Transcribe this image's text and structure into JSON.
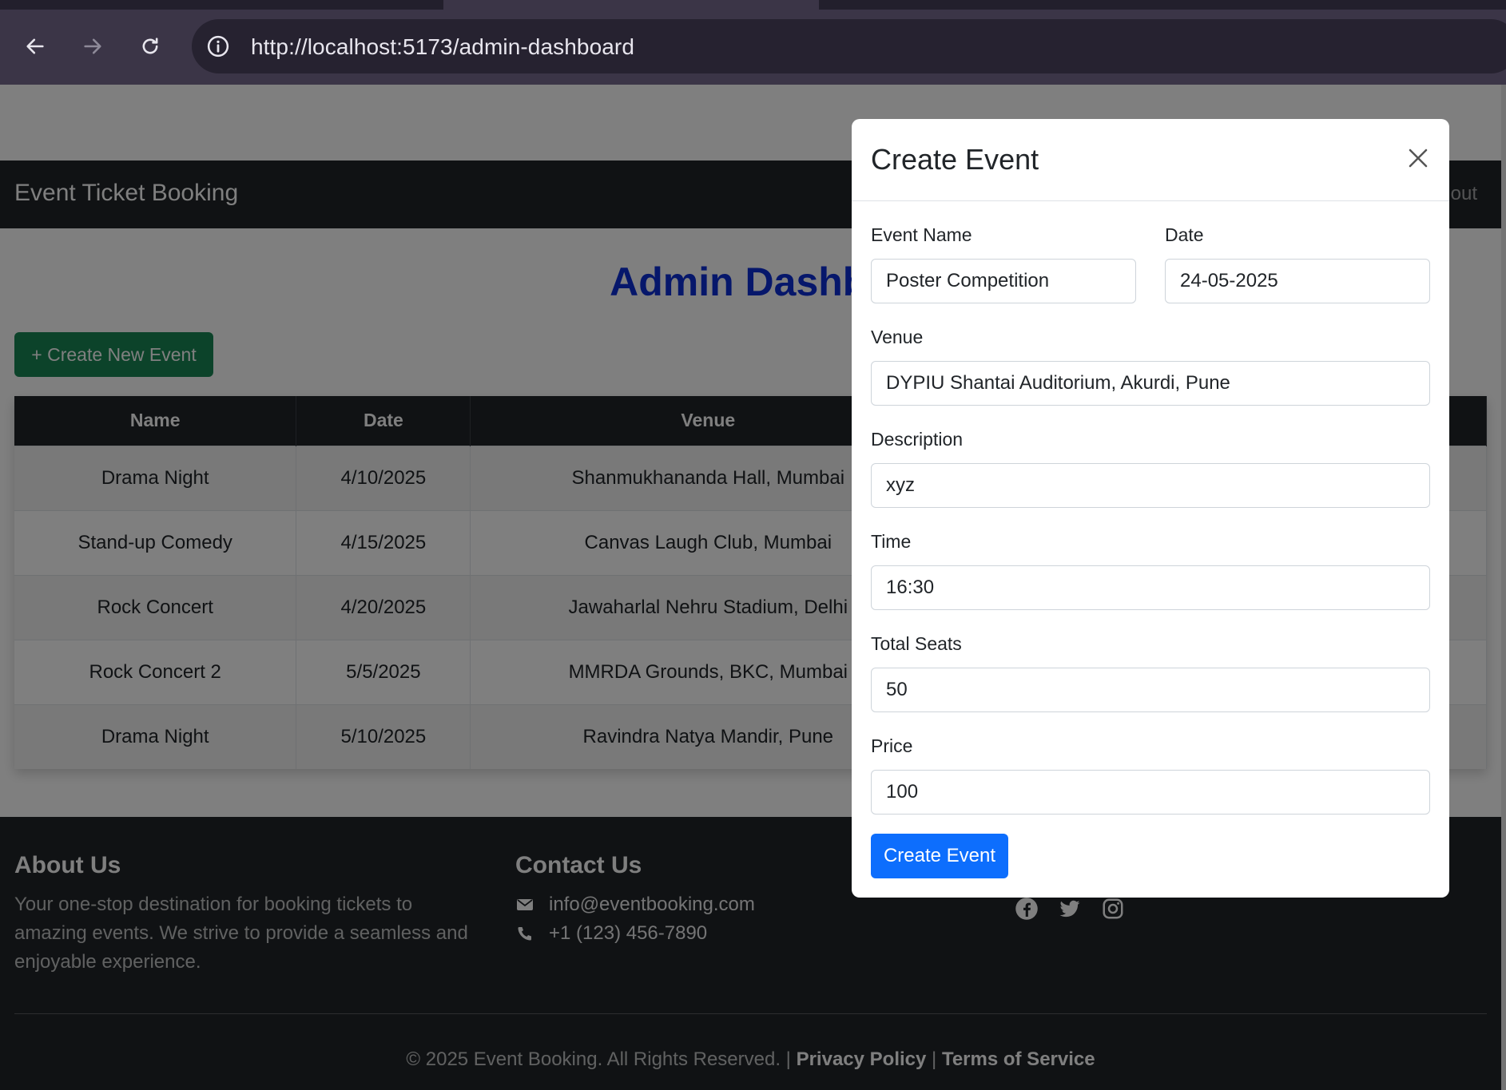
{
  "browser": {
    "url": "http://localhost:5173/admin-dashboard"
  },
  "navbar": {
    "brand": "Event Ticket Booking",
    "logout_partial": "out"
  },
  "dashboard": {
    "title": "Admin Dashbo",
    "create_button": "+ Create New Event"
  },
  "table": {
    "headers": [
      "Name",
      "Date",
      "Venue"
    ],
    "rows": [
      {
        "name": "Drama Night",
        "date": "4/10/2025",
        "venue": "Shanmukhananda Hall, Mumbai"
      },
      {
        "name": "Stand-up Comedy",
        "date": "4/15/2025",
        "venue": "Canvas Laugh Club, Mumbai"
      },
      {
        "name": "Rock Concert",
        "date": "4/20/2025",
        "venue": "Jawaharlal Nehru Stadium, Delhi"
      },
      {
        "name": "Rock Concert 2",
        "date": "5/5/2025",
        "venue": "MMRDA Grounds, BKC, Mumbai"
      },
      {
        "name": "Drama Night",
        "date": "5/10/2025",
        "venue": "Ravindra Natya Mandir, Pune"
      }
    ]
  },
  "footer": {
    "about_title": "About Us",
    "about_text": "Your one-stop destination for booking tickets to amazing events. We strive to provide a seamless and enjoyable experience.",
    "contact_title": "Contact Us",
    "email": "info@eventbooking.com",
    "phone": "+1 (123) 456-7890",
    "copyright": "© 2025 Event Booking. All Rights Reserved. |",
    "privacy": "Privacy Policy",
    "separator": "|",
    "terms": "Terms of Service"
  },
  "modal": {
    "title": "Create Event",
    "fields": {
      "event_name": {
        "label": "Event Name",
        "value": "Poster Competition"
      },
      "date": {
        "label": "Date",
        "value": "24-05-2025"
      },
      "venue": {
        "label": "Venue",
        "value": "DYPIU Shantai Auditorium, Akurdi, Pune"
      },
      "description": {
        "label": "Description",
        "value": "xyz"
      },
      "time": {
        "label": "Time",
        "value": "16:30"
      },
      "total_seats": {
        "label": "Total Seats",
        "value": "50"
      },
      "price": {
        "label": "Price",
        "value": "100"
      }
    },
    "submit_label": "Create Event"
  },
  "colors": {
    "brand_dark": "#212529",
    "accent_blue": "#0d6efd",
    "success_green": "#198754",
    "title_blue": "#0d2fd6"
  },
  "icons": [
    "back-arrow-icon",
    "forward-arrow-icon",
    "reload-icon",
    "info-icon",
    "envelope-icon",
    "phone-icon",
    "facebook-icon",
    "twitter-icon",
    "instagram-icon",
    "close-icon"
  ]
}
